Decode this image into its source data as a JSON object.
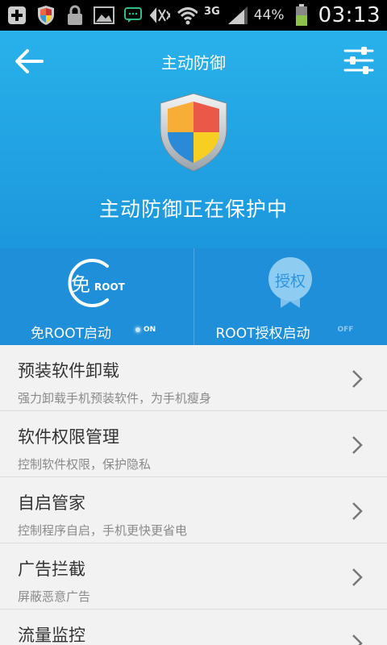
{
  "status_bar": {
    "icons": [
      "plus-icon",
      "shield-icon",
      "lock-icon",
      "image-icon",
      "chat-icon",
      "mute-icon",
      "wifi-icon",
      "signal-icon",
      "battery-icon"
    ],
    "network": "3G",
    "battery": "44%",
    "time": "03:13"
  },
  "header": {
    "title": "主动防御",
    "status": "主动防御正在保护中"
  },
  "toggles": {
    "left": {
      "icon_char": "免",
      "icon_sub": "ROOT",
      "label": "免ROOT启动",
      "state": "ON"
    },
    "right": {
      "icon_text": "授权",
      "label": "ROOT授权启动",
      "state": "OFF"
    }
  },
  "list": {
    "items": [
      {
        "title": "预装软件卸载",
        "subtitle": "强力卸载手机预装软件，为手机瘦身"
      },
      {
        "title": "软件权限管理",
        "subtitle": "控制软件权限，保护隐私"
      },
      {
        "title": "自启管家",
        "subtitle": "控制程序自启，手机更快更省电"
      },
      {
        "title": "广告拦截",
        "subtitle": "屏蔽恶意广告"
      },
      {
        "title": "流量监控",
        "subtitle": ""
      }
    ]
  },
  "colors": {
    "header_top": "#29b1ea",
    "header_bottom": "#1c97dd",
    "panel": "#1e8fd8"
  }
}
